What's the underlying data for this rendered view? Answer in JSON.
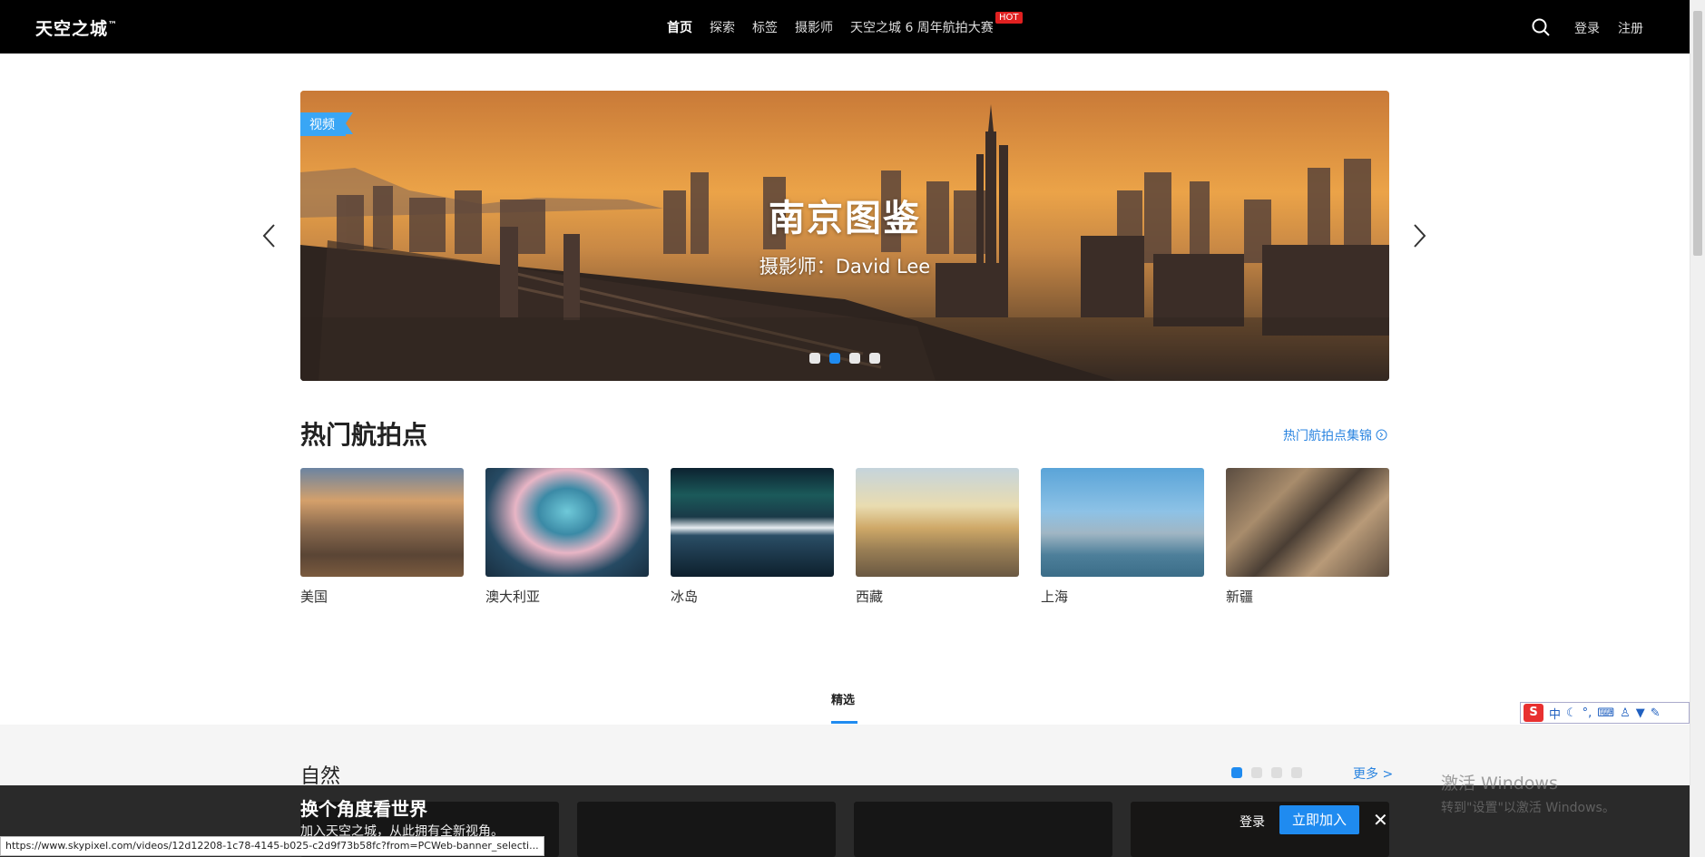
{
  "header": {
    "logo": "天空之城",
    "logo_tm": "™",
    "nav": [
      "首页",
      "探索",
      "标签",
      "摄影师",
      "天空之城 6 周年航拍大赛"
    ],
    "hot_badge": "HOT",
    "login": "登录",
    "register": "注册"
  },
  "banner": {
    "tag": "视频",
    "title": "南京图鉴",
    "subtitle": "摄影师：David Lee",
    "slide_count": 4,
    "active_slide": 2
  },
  "hot_spots": {
    "title": "热门航拍点",
    "more_link": "热门航拍点集锦",
    "items": [
      {
        "name": "美国"
      },
      {
        "name": "澳大利亚"
      },
      {
        "name": "冰岛"
      },
      {
        "name": "西藏"
      },
      {
        "name": "上海"
      },
      {
        "name": "新疆"
      }
    ]
  },
  "tabs": {
    "selected": "精选"
  },
  "nature": {
    "title": "自然",
    "more": "更多 >",
    "page_count": 4,
    "active_page": 1
  },
  "join_bar": {
    "title": "换个角度看世界",
    "subtitle": "加入天空之城，从此拥有全新视角。",
    "login": "登录",
    "join_button": "立即加入",
    "close": "✕"
  },
  "status_url": "https://www.skypixel.com/videos/12d12208-1c78-4145-b025-c2d9f73b58fc?from=PCWeb-banner_selecti...",
  "ime": {
    "logo": "S",
    "mode": "中"
  },
  "watermark": {
    "line1": "激活 Windows",
    "line2": "转到\"设置\"以激活 Windows。"
  },
  "colors": {
    "accent": "#1f8bf0",
    "hot": "#e02020",
    "topbar": "#000000"
  }
}
